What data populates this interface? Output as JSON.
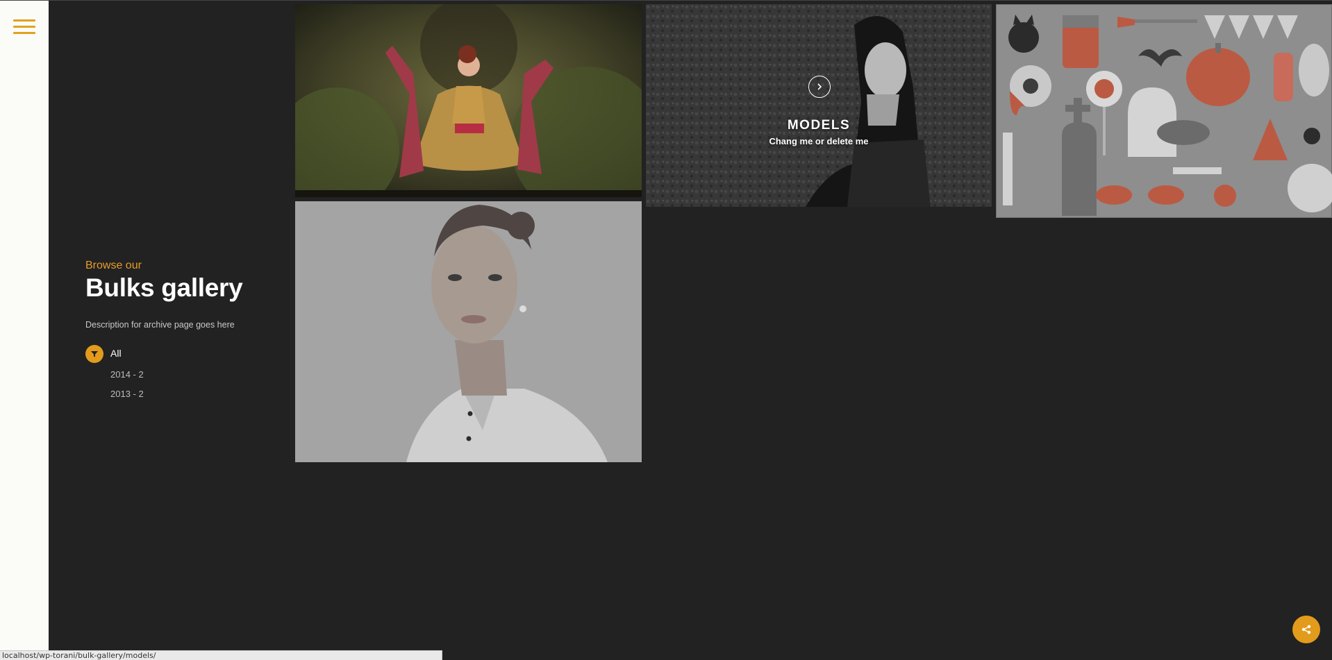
{
  "sidebar": {
    "menu_icon": "hamburger-icon"
  },
  "intro": {
    "kicker": "Browse our",
    "title": "Bulks gallery",
    "description": "Description for archive page goes here"
  },
  "filters": {
    "icon": "filter-icon",
    "items": [
      {
        "label": "All",
        "active": true
      },
      {
        "label": "2014 - 2",
        "active": false
      },
      {
        "label": "2013 - 2",
        "active": false
      }
    ]
  },
  "gallery": {
    "items": [
      {
        "image": "woman-in-gown-forest-photo"
      },
      {
        "image": "woman-grayscale-field-photo",
        "hover_title": "MODELS",
        "hover_subtitle": "Chang me or delete me",
        "hover_icon": "chevron-right-icon"
      },
      {
        "image": "halloween-icons-pattern"
      },
      {
        "image": "woman-white-shirt-portrait-photo"
      }
    ]
  },
  "share": {
    "icon": "share-icon"
  },
  "status_bar": {
    "url": "localhost/wp-torani/bulk-gallery/models/"
  },
  "colors": {
    "accent": "#e39b1c",
    "background": "#222222",
    "rail": "#fbfbf7"
  }
}
